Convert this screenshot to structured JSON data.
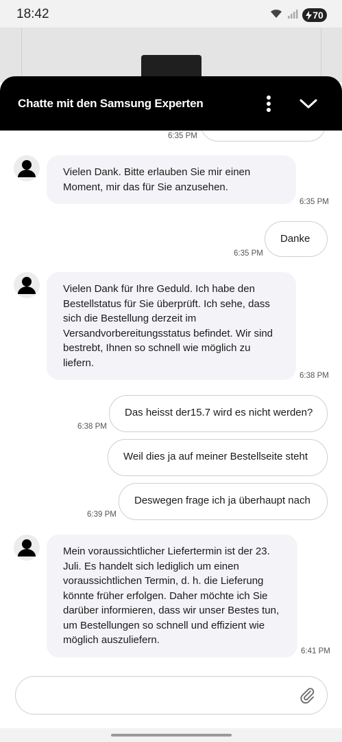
{
  "status_bar": {
    "time": "18:42",
    "battery": "70"
  },
  "header": {
    "title": "Chatte mit den Samsung Experten"
  },
  "messages": [
    {
      "sender": "user",
      "text": "",
      "time": "6:35 PM"
    },
    {
      "sender": "agent",
      "text": "Vielen Dank. Bitte erlauben Sie mir einen Moment, mir das für Sie anzusehen.",
      "time": "6:35 PM"
    },
    {
      "sender": "user",
      "text": "Danke",
      "time": "6:35 PM"
    },
    {
      "sender": "agent",
      "text": "Vielen Dank für Ihre Geduld. Ich habe den Bestellstatus für Sie überprüft. Ich sehe, dass sich die Bestellung derzeit im Versandvorbereitungsstatus befindet. Wir sind bestrebt, Ihnen so schnell wie möglich zu liefern.",
      "time": "6:38 PM"
    },
    {
      "sender": "user",
      "text": "Das heisst der15.7 wird es nicht werden?",
      "time": "6:38 PM"
    },
    {
      "sender": "user",
      "text": "Weil dies ja auf meiner Bestellseite steht",
      "time": ""
    },
    {
      "sender": "user",
      "text": "Deswegen frage ich ja überhaupt nach",
      "time": "6:39 PM"
    },
    {
      "sender": "agent",
      "text": "Mein voraussichtlicher Liefertermin ist der 23. Juli. Es handelt sich lediglich um einen voraussichtlichen Termin, d. h. die Lieferung könnte früher erfolgen. Daher möchte ich Sie darüber informieren, dass wir unser Bestes tun, um Bestellungen so schnell und effizient wie möglich auszuliefern.",
      "time": "6:41 PM"
    }
  ],
  "composer": {
    "value": "",
    "placeholder": ""
  },
  "colors": {
    "header_bg": "#000000",
    "agent_bubble": "#f4f4f8",
    "user_bubble_border": "#cfcfcf"
  },
  "icons": [
    "wifi-icon",
    "signal-icon",
    "battery-charging-icon",
    "more-vertical-icon",
    "chevron-down-icon",
    "avatar-icon",
    "paperclip-icon"
  ]
}
